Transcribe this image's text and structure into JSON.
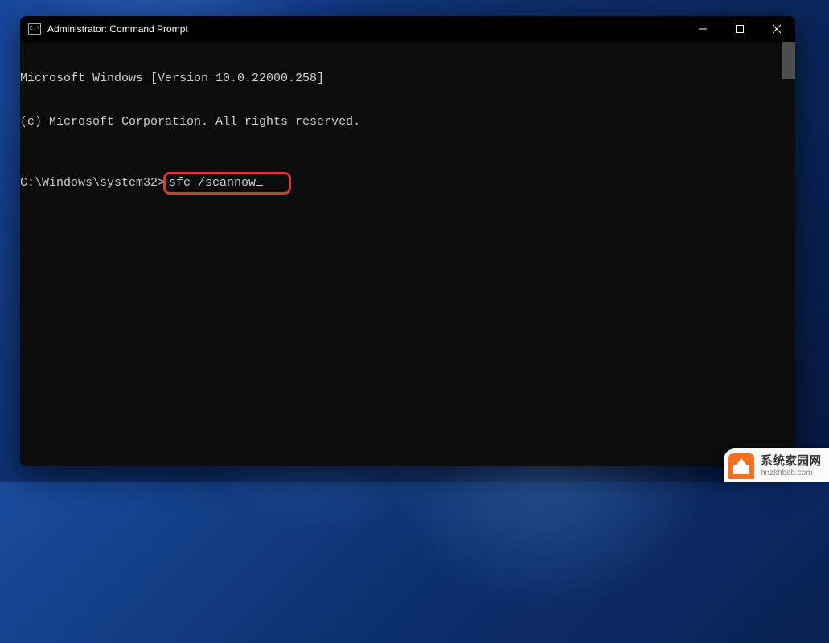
{
  "window": {
    "title": "Administrator: Command Prompt",
    "icon_label": "cmd-icon"
  },
  "terminal": {
    "line1": "Microsoft Windows [Version 10.0.22000.258]",
    "line2": "(c) Microsoft Corporation. All rights reserved.",
    "prompt": "C:\\Windows\\system32>",
    "command": "sfc /scannow"
  },
  "highlight": {
    "color": "#d93838"
  },
  "watermark": {
    "title": "系统家园网",
    "url": "hnzkhbsb.com"
  }
}
